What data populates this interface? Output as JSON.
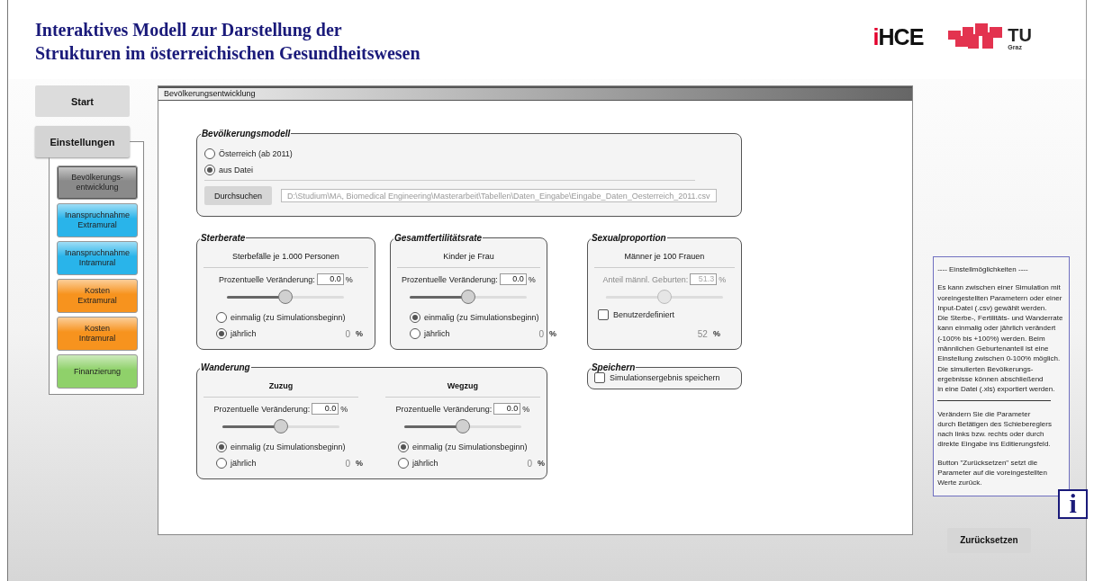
{
  "header": {
    "title_lines": [
      "Interaktives Modell zur Darstellung der",
      "Strukturen im österreichischen Gesundheitswesen"
    ],
    "ihce_logo": {
      "accent": "i",
      "text": "HCE"
    },
    "tu_logo": {
      "text": "TU",
      "subtext": "Graz"
    }
  },
  "nav": {
    "items": [
      {
        "label": "Start",
        "selected": false,
        "expanded": false
      },
      {
        "label": "Einstellungen",
        "selected": true,
        "expanded": true
      }
    ],
    "subitems": [
      {
        "label": "Bevölkerungs-\nentwicklung",
        "selected": true,
        "color": "#8a8a8a"
      },
      {
        "label": "Inanspruchnahme\nExtramural",
        "selected": false,
        "color": "#29b4ea"
      },
      {
        "label": "Inanspruchnahme\nIntramural",
        "selected": false,
        "color": "#29b4ea"
      },
      {
        "label": "Kosten\nExtramural",
        "selected": false,
        "color": "#f7931e"
      },
      {
        "label": "Kosten\nIntramural",
        "selected": false,
        "color": "#f7931e"
      },
      {
        "label": "Finanzierung",
        "selected": false,
        "color": "#8fd16a"
      }
    ]
  },
  "panel": {
    "title": "Bevölkerungsentwicklung",
    "model": {
      "legend": "Bevölkerungsmodell",
      "options": [
        {
          "label": "Österreich (ab 2011)",
          "selected": false
        },
        {
          "label": "aus Datei",
          "selected": true
        }
      ],
      "browse_button": "Durchsuchen",
      "path": "D:\\Studium\\MA, Biomedical Engineering\\Masterarbeit\\Tabellen\\Daten_Eingabe\\Eingabe_Daten_Oesterreich_2011.csv"
    },
    "sterberate": {
      "legend": "Sterberate",
      "subtitle": "Sterbefälle je 1.000 Personen",
      "change_label": "Prozentuelle Veränderung:",
      "value": "0.0",
      "unit": "%",
      "level": 0.5,
      "options": [
        {
          "label": "einmalig (zu Simulationsbeginn)",
          "selected": false
        },
        {
          "label": "jährlich",
          "selected": true
        }
      ],
      "result": "0",
      "result_unit": "%"
    },
    "fertility": {
      "legend": "Gesamtfertilitätsrate",
      "subtitle": "Kinder je Frau",
      "change_label": "Prozentuelle Veränderung:",
      "value": "0.0",
      "unit": "%",
      "level": 0.5,
      "options": [
        {
          "label": "einmalig (zu Simulationsbeginn)",
          "selected": true
        },
        {
          "label": "jährlich",
          "selected": false
        }
      ],
      "result": "0",
      "result_unit": "%"
    },
    "sex_ratio": {
      "legend": "Sexualproportion",
      "subtitle": "Männer je 100 Frauen",
      "change_label": "Anteil männl. Geburten:",
      "value": "51.3",
      "unit": "%",
      "disabled": true,
      "level": 0.5,
      "custom": {
        "label": "Benutzerdefiniert",
        "checked": false
      },
      "result": "52",
      "result_unit": "%"
    },
    "migration": {
      "legend": "Wanderung",
      "columns": [
        {
          "subtitle": "Zuzug",
          "change_label": "Prozentuelle Veränderung:",
          "value": "0.0",
          "unit": "%",
          "level": 0.5,
          "options": [
            {
              "label": "einmalig (zu Simulationsbeginn)",
              "selected": true
            },
            {
              "label": "jährlich",
              "selected": false
            }
          ],
          "result": "0",
          "result_unit": "%"
        },
        {
          "subtitle": "Wegzug",
          "change_label": "Prozentuelle Veränderung:",
          "value": "0.0",
          "unit": "%",
          "level": 0.5,
          "options": [
            {
              "label": "einmalig (zu Simulationsbeginn)",
              "selected": true
            },
            {
              "label": "jährlich",
              "selected": false
            }
          ],
          "result": "0",
          "result_unit": "%"
        }
      ]
    },
    "save": {
      "legend": "Speichern",
      "label": "Simulationsergebnis speichern",
      "checked": false
    }
  },
  "info": {
    "heading": "---- Einstellmöglichkeiten ----",
    "paragraphs": [
      "Es kann zwischen einer Simulation mit\nvoreingestellten Parametern oder einer\nInput-Datei (.csv) gewählt werden.\nDie Sterbe-, Fertilitäts- und Wanderrate\nkann einmalig oder jährlich verändert\n(-100% bis +100%) werden. Beim\nmännlichen Geburtenanteil ist eine\nEinstellung zwischen 0-100% möglich.\nDie simulierten Bevölkerungs-\nergebnisse können abschließend\nin eine Datei (.xls) exportiert werden.",
      "Verändern Sie die Parameter\ndurch Betätigen des Schiebereglers\nnach links bzw. rechts oder durch\ndirekte Eingabe ins Editierungsfeld.",
      "Button \"Zurücksetzen\" setzt die\nParameter auf die voreingestellten\nWerte zurück."
    ],
    "icon_letter": "i"
  },
  "reset_button": "Zurücksetzen"
}
